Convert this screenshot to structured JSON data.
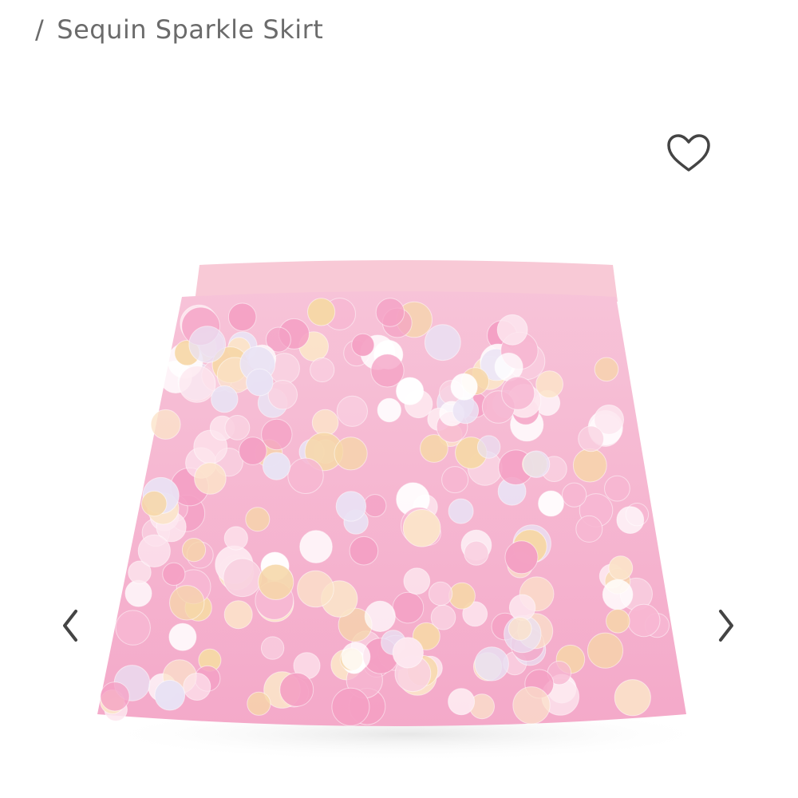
{
  "breadcrumb": {
    "separator": "/",
    "current": "Sequin Sparkle Skirt"
  },
  "icons": {
    "favorite": "heart-outline-icon",
    "previous": "chevron-left-icon",
    "next": "chevron-right-icon"
  },
  "colors": {
    "text": "#6b6b6b",
    "icon": "#444444",
    "skirt_base": "#f6b9d3",
    "waistband": "#f8c9d6"
  }
}
